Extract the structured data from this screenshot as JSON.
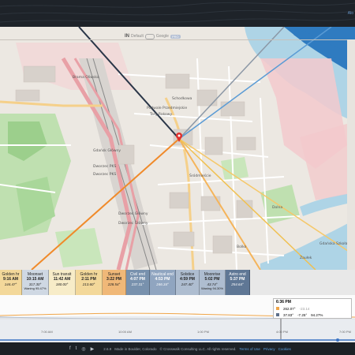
{
  "app": {
    "top_hint": "Alo"
  },
  "tile_switch": {
    "label_left": "Default",
    "label_right": "Google",
    "badge": "PRO"
  },
  "map_labels": {
    "district": "Brama Oliwska",
    "station1": "Gdańsk Główny",
    "station2": "Dworzec PKS",
    "station3": "Dworzec PKS",
    "station4": "Dworzec Główny",
    "station5": "Dworzec Główny",
    "street1": "Podwale Przedmiejskie",
    "street2": "Targ Rakowy",
    "poi1": "Schodkowa",
    "quarter": "Śródmieście",
    "area1": "Bolko",
    "area2": "Zaułek",
    "area3": "Gdańska Szkoła",
    "area4": "Dolna"
  },
  "timeline": [
    {
      "title": "Golden hr",
      "time": "9:16 AM",
      "az": "144.47°",
      "bg": "#f3d89a"
    },
    {
      "title": "Moonset",
      "icon": "moonset",
      "time": "10:15 AM",
      "az": "317.30°",
      "note": "Waning 95.47%",
      "bg": "#cfd8e3"
    },
    {
      "title": "Sun transit",
      "time": "11:42 AM",
      "az": "180.00°",
      "bg": "#f7ecc8"
    },
    {
      "title": "Golden hr",
      "time": "2:11 PM",
      "az": "213.60°",
      "bg": "#f3d89a"
    },
    {
      "title": "Sunset",
      "icon": "sunset",
      "time": "3:22 PM",
      "az": "228.54°",
      "bg": "#f0b878"
    },
    {
      "title": "Civil end",
      "time": "4:07 PM",
      "az": "237.31°",
      "bg": "#7891ad"
    },
    {
      "title": "Nautical end",
      "time": "4:53 PM",
      "az": "246.34°",
      "bg": "#90a5c0"
    },
    {
      "title": "Solstice",
      "icon": "solstice",
      "time": "4:59 PM",
      "az": "247.40°",
      "bg": "#aebdd0"
    },
    {
      "title": "Moonrise",
      "icon": "moonrise",
      "time": "5:02 PM",
      "az": "43.74°",
      "note": "Waning 94.30%",
      "bg": "#aebdd0"
    },
    {
      "title": "Astro end",
      "time": "5:37 PM",
      "az": "254.64°",
      "bg": "#5f7795"
    }
  ],
  "readout": {
    "time": "6:36 PM",
    "sun_values": [
      "262.07°",
      "-23.14",
      ""
    ],
    "moon_values": [
      "37.83°",
      "-7.25°",
      "94.27%"
    ]
  },
  "hour_ticks": [
    "7:00 AM",
    "10:00 AM",
    "1:00 PM",
    "4:00 PM",
    "7:00 PM"
  ],
  "footer": {
    "version": "2.6.9",
    "made_in": "Made in Boulder, Colorado",
    "copyright": "© Crosswalk Consulting LLC. All rights reserved.",
    "terms": "Terms of Use",
    "privacy": "Privacy",
    "cookies": "Cookies"
  }
}
